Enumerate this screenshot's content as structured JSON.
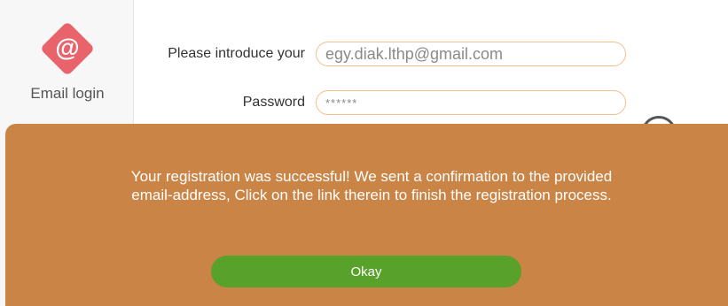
{
  "sidebar": {
    "items": [
      {
        "icon": "at-sign-icon",
        "glyph": "@",
        "label": "Email login",
        "accent": "#e9636b"
      }
    ]
  },
  "form": {
    "email": {
      "label": "Please introduce your",
      "value": "egy.diak.lthp@gmail.com"
    },
    "password": {
      "label": "Password",
      "value": "******"
    },
    "input_border_color": "#f2c08f"
  },
  "modal": {
    "message_line1": "Your registration was successful! We sent a confirmation to the provided",
    "message_line2": "email-address, Click on the link therein to finish the registration process.",
    "okay_label": "Okay",
    "background_color": "#c98446",
    "button_color": "#58a12a"
  }
}
